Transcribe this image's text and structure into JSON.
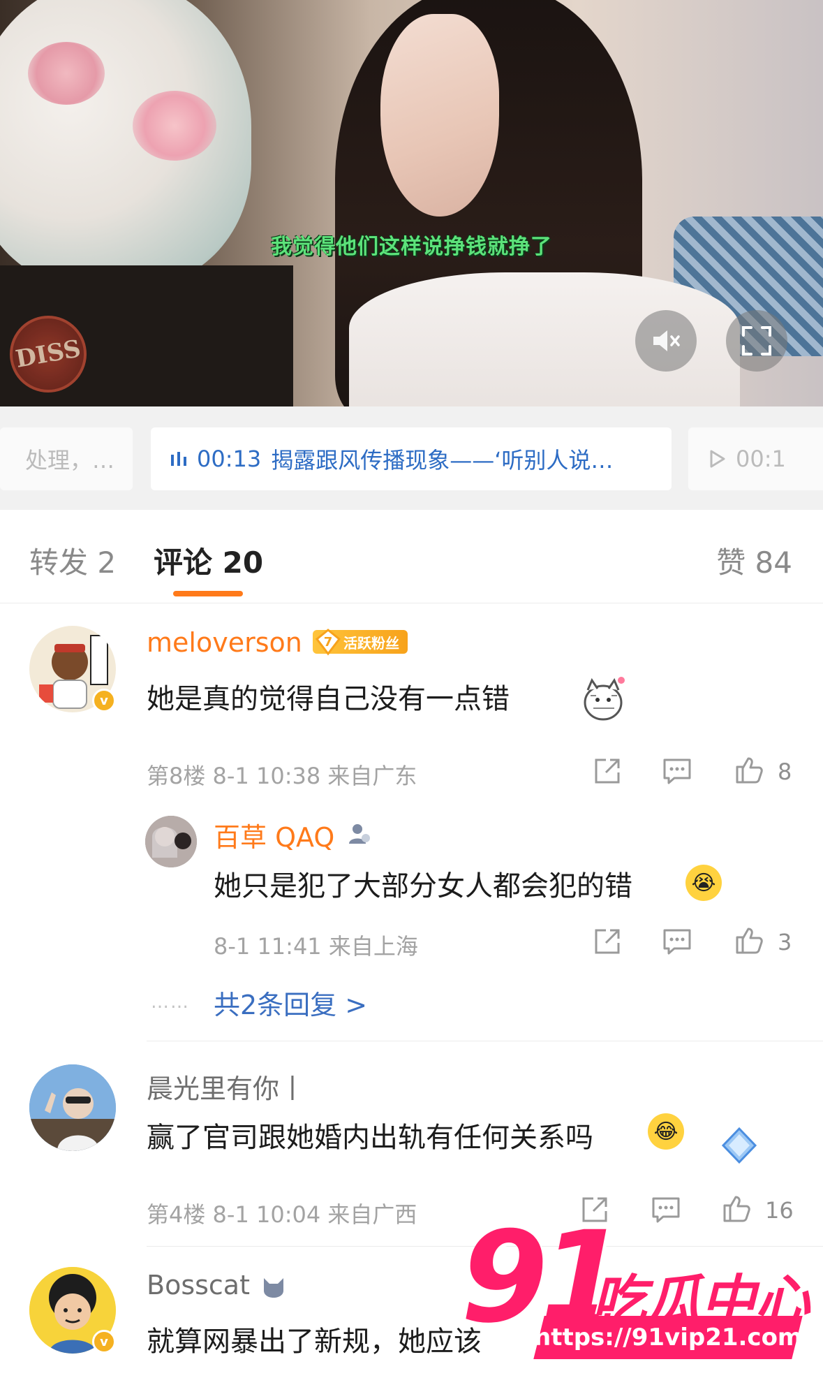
{
  "video": {
    "subtitle": "我觉得他们这样说挣钱就挣了",
    "logo_text": "DISS"
  },
  "chapters": {
    "left_label": "处理，…",
    "active_time": "00:13",
    "active_title": "揭露跟风传播现象——‘听别人说…",
    "right_time": "00:1"
  },
  "tabs": {
    "repost_label": "转发 2",
    "comment_label": "评论 20",
    "like_label": "赞 84"
  },
  "comments": [
    {
      "user": "meloverson",
      "fan_level": "7",
      "fan_badge": "活跃粉丝",
      "text": "她是真的觉得自己没有一点错",
      "meta": "第8楼  8-1 10:38  来自广东",
      "likes": "8"
    },
    {
      "user": "晨光里有你丨",
      "text": "赢了官司跟她婚内出轨有任何关系吗",
      "meta": "第4楼  8-1 10:04  来自广西",
      "likes": "16"
    },
    {
      "user": "Bosscat",
      "text": "就算网暴出了新规，她应该"
    }
  ],
  "reply": {
    "user": "百草 QAQ",
    "text": "她只是犯了大部分女人都会犯的错",
    "meta": "8-1 11:41  来自上海",
    "likes": "3",
    "more": "共2条回复 >",
    "dots": "……"
  },
  "watermark": {
    "number": "91",
    "text": "吃瓜中心",
    "url": "https://91vip21.com"
  },
  "colors": {
    "accent": "#ff7a1a",
    "link": "#2d6cc4",
    "watermark": "#ff1e6a"
  }
}
